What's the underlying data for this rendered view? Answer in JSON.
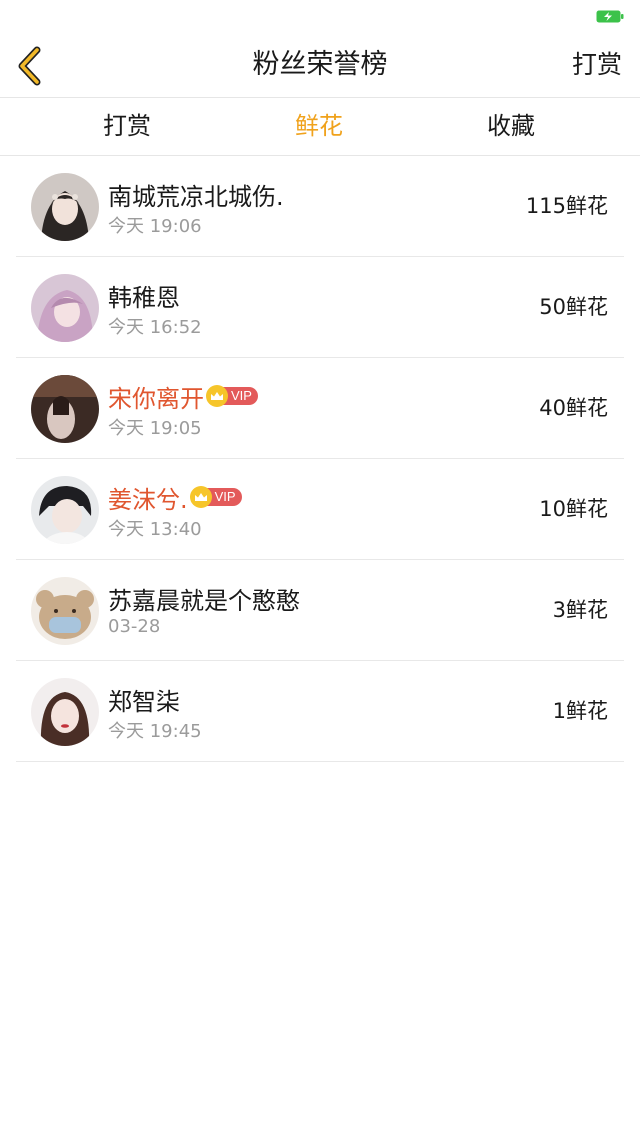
{
  "status_bar": {
    "battery_icon": "battery-charging-icon",
    "battery_color": "#3cc24a"
  },
  "header": {
    "back_icon": "chevron-left-icon",
    "title": "粉丝荣誉榜",
    "action_label": "打赏"
  },
  "tabs": [
    {
      "label": "打赏",
      "active": false
    },
    {
      "label": "鲜花",
      "active": true
    },
    {
      "label": "收藏",
      "active": false
    }
  ],
  "colors": {
    "accent": "#f0a21c",
    "vip_name": "#e0562f",
    "vip_tag": "#e35a5a",
    "crown": "#f6c52a"
  },
  "fans": [
    {
      "name": "南城荒凉北城伤.",
      "time": "今天 19:06",
      "count": "115鲜花",
      "vip": false
    },
    {
      "name": "韩稚恩",
      "time": "今天 16:52",
      "count": "50鲜花",
      "vip": false
    },
    {
      "name": "宋你离开",
      "time": "今天 19:05",
      "count": "40鲜花",
      "vip": true,
      "vip_label": "VIP"
    },
    {
      "name": "姜沫兮.",
      "time": "今天 13:40",
      "count": "10鲜花",
      "vip": true,
      "vip_label": "VIP"
    },
    {
      "name": "苏嘉晨就是个憨憨",
      "time": "03-28",
      "count": "3鲜花",
      "vip": false
    },
    {
      "name": "郑智柒",
      "time": "今天 19:45",
      "count": "1鲜花",
      "vip": false
    }
  ]
}
